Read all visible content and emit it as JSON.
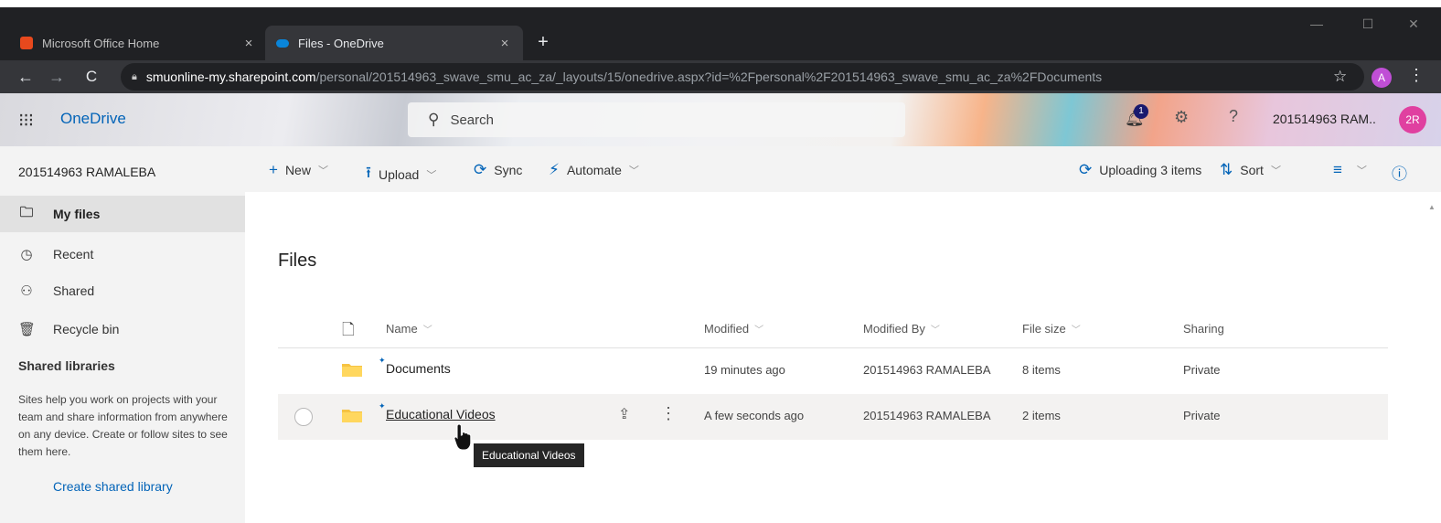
{
  "browser": {
    "tabs": [
      {
        "label": "Microsoft Office Home",
        "close": "×",
        "icon": "office-icon"
      },
      {
        "label": "Files - OneDrive",
        "close": "×",
        "icon": "onedrive-icon"
      }
    ],
    "new_tab": "+",
    "window": {
      "minimize": "—",
      "maximize": "☐",
      "close": "✕"
    },
    "url_host": "smuonline-my.sharepoint.com",
    "url_path": "/personal/201514963_swave_smu_ac_za/_layouts/15/onedrive.aspx?id=%2Fpersonal%2F201514963_swave_smu_ac_za%2FDocuments",
    "profile_letter": "A"
  },
  "header": {
    "app_name": "OneDrive",
    "search_placeholder": "Search",
    "notification_count": "1",
    "user_name": "201514963 RAM..",
    "avatar_initials": "2R"
  },
  "sidebar": {
    "user": "201514963 RAMALEBA",
    "items": [
      {
        "label": "My files",
        "icon": "folder-icon",
        "selected": true
      },
      {
        "label": "Recent",
        "icon": "clock-icon"
      },
      {
        "label": "Shared",
        "icon": "people-icon"
      },
      {
        "label": "Recycle bin",
        "icon": "trash-icon"
      }
    ],
    "libraries_heading": "Shared libraries",
    "libraries_description": "Sites help you work on projects with your team and share information from anywhere on any device. Create or follow sites to see them here.",
    "create_library": "Create shared library"
  },
  "commands": {
    "new": "New",
    "upload": "Upload",
    "sync": "Sync",
    "automate": "Automate",
    "uploading": "Uploading 3 items",
    "sort": "Sort"
  },
  "main": {
    "title": "Files",
    "columns": [
      "Name",
      "Modified",
      "Modified By",
      "File size",
      "Sharing"
    ],
    "rows": [
      {
        "name": "Documents",
        "modified": "19 minutes ago",
        "modified_by": "201514963 RAMALEBA",
        "size": "8 items",
        "sharing": "Private"
      },
      {
        "name": "Educational Videos",
        "modified": "A few seconds ago",
        "modified_by": "201514963 RAMALEBA",
        "size": "2 items",
        "sharing": "Private"
      }
    ],
    "tooltip": "Educational Videos"
  },
  "colors": {
    "brand": "#0364b8",
    "chrome_dark": "#202124",
    "avatar": "#e040a0"
  }
}
